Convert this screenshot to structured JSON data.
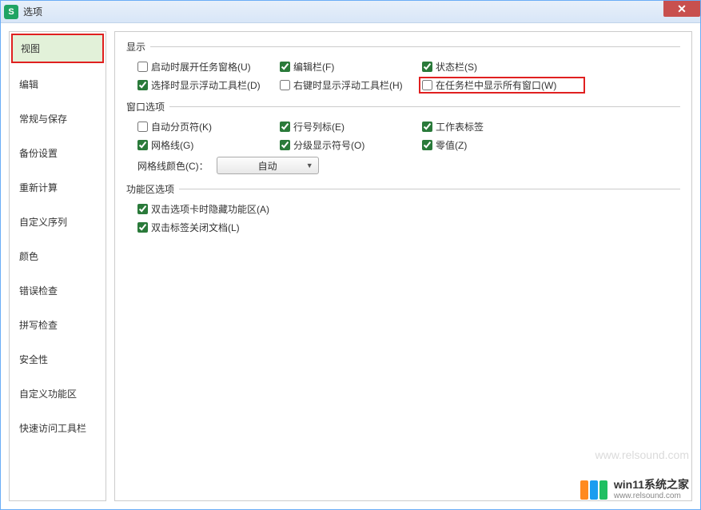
{
  "window": {
    "title": "选项",
    "icon_letter": "S"
  },
  "sidebar": {
    "items": [
      {
        "label": "视图",
        "active": true
      },
      {
        "label": "编辑",
        "active": false
      },
      {
        "label": "常规与保存",
        "active": false
      },
      {
        "label": "备份设置",
        "active": false
      },
      {
        "label": "重新计算",
        "active": false
      },
      {
        "label": "自定义序列",
        "active": false
      },
      {
        "label": "颜色",
        "active": false
      },
      {
        "label": "错误检查",
        "active": false
      },
      {
        "label": "拼写检查",
        "active": false
      },
      {
        "label": "安全性",
        "active": false
      },
      {
        "label": "自定义功能区",
        "active": false
      },
      {
        "label": "快速访问工具栏",
        "active": false
      }
    ]
  },
  "sections": {
    "display": {
      "title": "显示",
      "options": [
        {
          "label": "启动时展开任务窗格(U)",
          "checked": false
        },
        {
          "label": "编辑栏(F)",
          "checked": true
        },
        {
          "label": "状态栏(S)",
          "checked": true
        },
        {
          "label": "选择时显示浮动工具栏(D)",
          "checked": true
        },
        {
          "label": "右键时显示浮动工具栏(H)",
          "checked": false
        },
        {
          "label": "在任务栏中显示所有窗口(W)",
          "checked": false,
          "highlighted": true
        }
      ]
    },
    "window_opts": {
      "title": "窗口选项",
      "options": [
        {
          "label": "自动分页符(K)",
          "checked": false
        },
        {
          "label": "行号列标(E)",
          "checked": true
        },
        {
          "label": "工作表标签",
          "checked": true
        },
        {
          "label": "网格线(G)",
          "checked": true
        },
        {
          "label": "分级显示符号(O)",
          "checked": true
        },
        {
          "label": "零值(Z)",
          "checked": true
        }
      ],
      "gridline_color_label": "网格线颜色(C)：",
      "gridline_color_value": "自动"
    },
    "ribbon": {
      "title": "功能区选项",
      "options": [
        {
          "label": "双击选项卡时隐藏功能区(A)",
          "checked": true
        },
        {
          "label": "双击标签关闭文档(L)",
          "checked": true
        }
      ]
    }
  },
  "watermark": "www.relsound.com",
  "brand": {
    "name": "win11系统之家",
    "url": "www.relsound.com",
    "colors": [
      "#ff8a1f",
      "#1a9df0",
      "#1fbf62"
    ]
  }
}
